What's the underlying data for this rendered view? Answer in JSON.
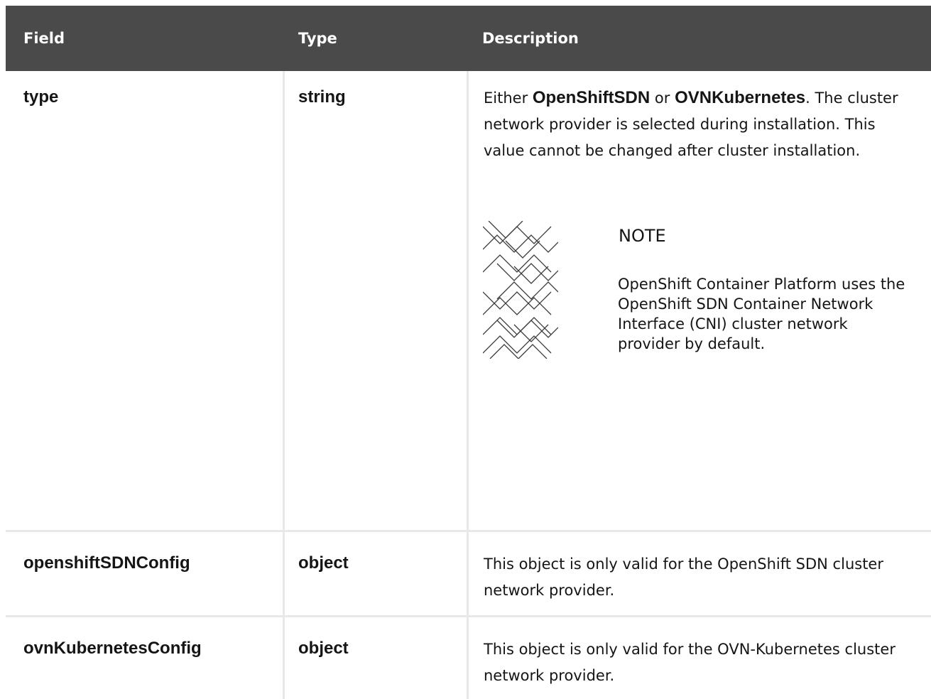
{
  "header": {
    "field": "Field",
    "type": "Type",
    "description": "Description"
  },
  "rows": [
    {
      "field": "type",
      "type": "string",
      "description": {
        "prefix": "Either ",
        "opt1": "OpenShiftSDN",
        "joiner": " or ",
        "opt2": "OVNKubernetes",
        "suffix": ". The cluster network provider is selected during installation. This value cannot be changed after cluster installation."
      },
      "note": {
        "icon": "note-pattern-icon",
        "title": "NOTE",
        "text": "OpenShift Container Platform uses the OpenShift SDN Container Network Interface (CNI) cluster network provider by default."
      }
    },
    {
      "field": "openshiftSDNConfig",
      "type": "object",
      "description": "This object is only valid for the OpenShift SDN cluster network provider."
    },
    {
      "field": "ovnKubernetesConfig",
      "type": "object",
      "description": "This object is only valid for the OVN-Kubernetes cluster network provider."
    }
  ],
  "colors": {
    "header_bg": "#4a4a4a",
    "header_text": "#ffffff",
    "grid_line": "#e8e8e8",
    "text": "#151515"
  }
}
